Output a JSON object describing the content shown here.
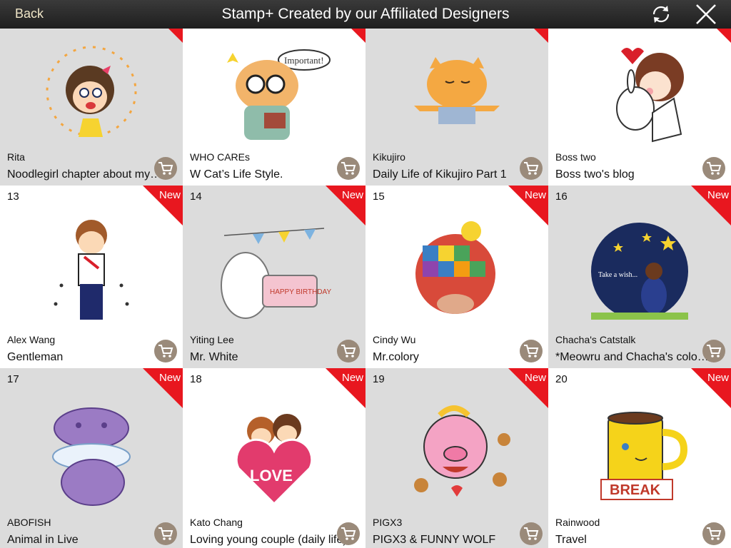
{
  "header": {
    "back_label": "Back",
    "title": "Stamp+ Created by our Affiliated Designers"
  },
  "new_label": "New",
  "tiles": [
    {
      "num": "",
      "author": "Rita",
      "title": "Noodlegirl chapter about my Sunny Day",
      "bg": "#dcdcdc",
      "new": false,
      "art_color": "#f6c340",
      "art_icon": "girl-sticker-icon"
    },
    {
      "num": "",
      "author": "WHO CAREs",
      "title": "W Cat’s Life Style.",
      "bg": "#ffffff",
      "new": false,
      "art_color": "#f2a94b",
      "art_icon": "cat-reading-icon"
    },
    {
      "num": "",
      "author": "Kikujiro",
      "title": "Daily Life of Kikujiro Part 1",
      "bg": "#dcdcdc",
      "new": false,
      "art_color": "#f5a941",
      "art_icon": "orange-cat-icon"
    },
    {
      "num": "",
      "author": "Boss two",
      "title": "Boss two's blog",
      "bg": "#ffffff",
      "new": false,
      "art_color": "#c0392b",
      "art_icon": "girl-rabbit-icon"
    },
    {
      "num": "13",
      "author": "Alex Wang",
      "title": "Gentleman",
      "bg": "#ffffff",
      "new": true,
      "art_color": "#1f2a6b",
      "art_icon": "gentleman-icon"
    },
    {
      "num": "14",
      "author": "Yiting Lee",
      "title": "Mr. White",
      "bg": "#dcdcdc",
      "new": true,
      "art_color": "#f4b7c4",
      "art_icon": "birthday-cake-icon"
    },
    {
      "num": "15",
      "author": "Cindy Wu",
      "title": "Mr.colory",
      "bg": "#ffffff",
      "new": true,
      "art_color": "#d84a3a",
      "art_icon": "patchwork-elephant-icon"
    },
    {
      "num": "16",
      "author": "Chacha's Catstalk",
      "title": "*Meowru and Chacha's colorful life*",
      "bg": "#dcdcdc",
      "new": true,
      "art_color": "#1a2b5e",
      "art_icon": "night-sky-girl-icon"
    },
    {
      "num": "17",
      "author": "ABOFISH",
      "title": "Animal in Live",
      "bg": "#dcdcdc",
      "new": true,
      "art_color": "#9b7bc4",
      "art_icon": "hippo-clam-icon"
    },
    {
      "num": "18",
      "author": "Kato Chang",
      "title": "Loving young couple (daily life)",
      "bg": "#ffffff",
      "new": true,
      "art_color": "#e23b6d",
      "art_icon": "love-couple-icon"
    },
    {
      "num": "19",
      "author": "PIGX3",
      "title": "PIGX3 & FUNNY WOLF",
      "bg": "#dcdcdc",
      "new": true,
      "art_color": "#f4a3c4",
      "art_icon": "pig-gingerbread-icon"
    },
    {
      "num": "20",
      "author": "Rainwood",
      "title": "Travel",
      "bg": "#ffffff",
      "new": true,
      "art_color": "#f5d31a",
      "art_icon": "break-mug-icon"
    }
  ]
}
